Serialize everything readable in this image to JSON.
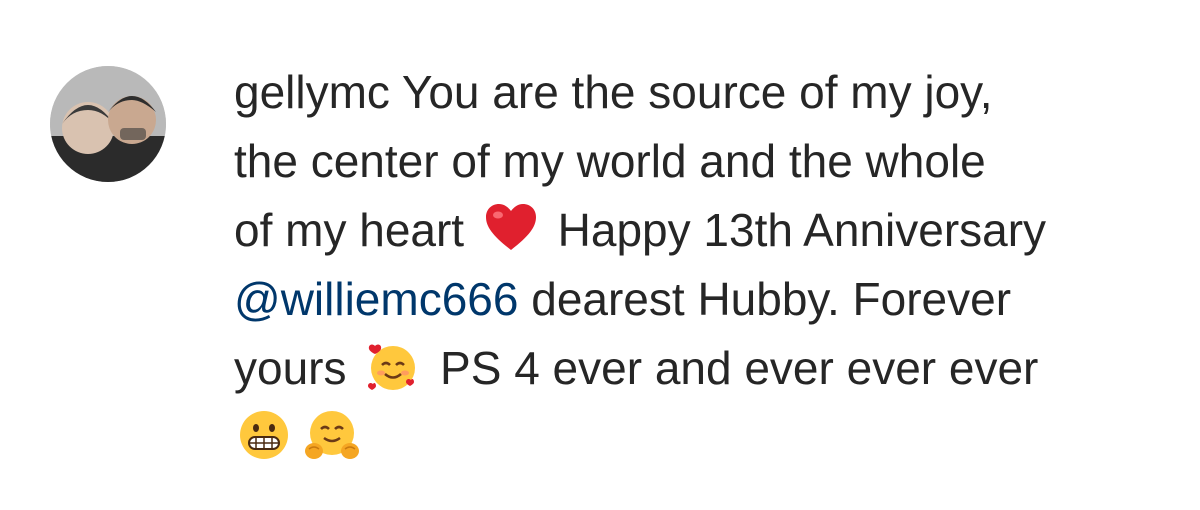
{
  "comment": {
    "username": "gellymc",
    "lines": [
      {
        "text_after_user": " You are the source of my joy,"
      },
      {
        "text": "the center of my world and the whole"
      },
      {
        "before": "of my heart ",
        "after": " Happy 13th Anniversary"
      },
      {
        "mention": "@williemc666",
        "after": " dearest Hubby. Forever"
      },
      {
        "before": "yours ",
        "after": " PS 4 ever and ever ever ever"
      }
    ],
    "emojis": {
      "heart": "red-heart-emoji",
      "smiling_hearts": "smiling-face-with-hearts-emoji",
      "grimacing": "grimacing-face-emoji",
      "hugging": "hugging-face-emoji"
    },
    "colors": {
      "text": "#262626",
      "mention": "#00376b",
      "heart": "#e0202e",
      "emoji_yellow": "#ffc83d"
    }
  }
}
